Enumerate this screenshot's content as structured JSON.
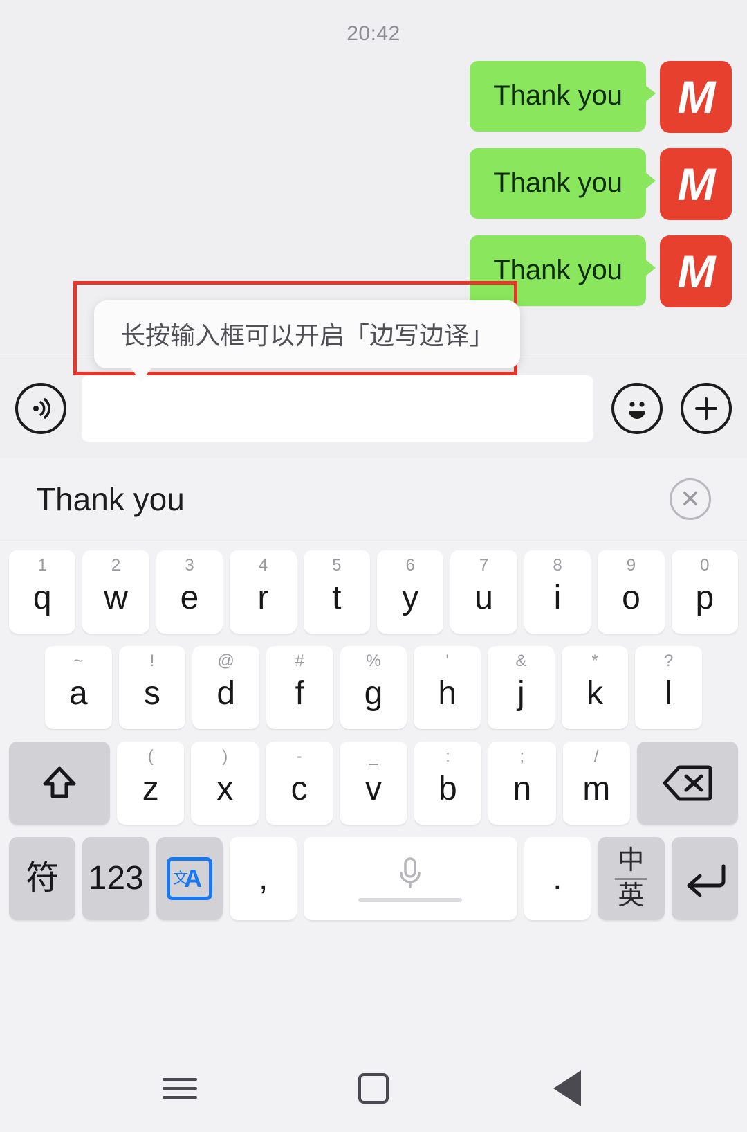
{
  "status": {
    "time": "20:42"
  },
  "chat": {
    "messages": [
      {
        "text": "Thank you",
        "avatar_letter": "M"
      },
      {
        "text": "Thank you",
        "avatar_letter": "M"
      },
      {
        "text": "Thank you",
        "avatar_letter": "M"
      }
    ],
    "bubble_color": "#8ae65c",
    "avatar_color": "#e8402f"
  },
  "tooltip": {
    "text": "长按输入框可以开启「边写边译」",
    "highlight_color": "#e8372a"
  },
  "input_bar": {
    "voice_icon": "voice-wave-icon",
    "field_value": "",
    "field_placeholder": "",
    "emoji_icon": "smiley-face-icon",
    "plus_icon": "plus-icon"
  },
  "keyboard": {
    "candidate": {
      "text": "Thank you",
      "close_icon": "close-circle-icon"
    },
    "row1": [
      {
        "hint": "1",
        "main": "q"
      },
      {
        "hint": "2",
        "main": "w"
      },
      {
        "hint": "3",
        "main": "e"
      },
      {
        "hint": "4",
        "main": "r"
      },
      {
        "hint": "5",
        "main": "t"
      },
      {
        "hint": "6",
        "main": "y"
      },
      {
        "hint": "7",
        "main": "u"
      },
      {
        "hint": "8",
        "main": "i"
      },
      {
        "hint": "9",
        "main": "o"
      },
      {
        "hint": "0",
        "main": "p"
      }
    ],
    "row2": [
      {
        "hint": "~",
        "main": "a"
      },
      {
        "hint": "!",
        "main": "s"
      },
      {
        "hint": "@",
        "main": "d"
      },
      {
        "hint": "#",
        "main": "f"
      },
      {
        "hint": "%",
        "main": "g"
      },
      {
        "hint": "'",
        "main": "h"
      },
      {
        "hint": "&",
        "main": "j"
      },
      {
        "hint": "*",
        "main": "k"
      },
      {
        "hint": "?",
        "main": "l"
      }
    ],
    "row3": [
      {
        "hint": "(",
        "main": "z"
      },
      {
        "hint": ")",
        "main": "x"
      },
      {
        "hint": "-",
        "main": "c"
      },
      {
        "hint": "_",
        "main": "v"
      },
      {
        "hint": ":",
        "main": "b"
      },
      {
        "hint": ";",
        "main": "n"
      },
      {
        "hint": "/",
        "main": "m"
      }
    ],
    "shift_key": {
      "name": "shift-key",
      "icon": "shift-arrow-icon"
    },
    "backspace_key": {
      "name": "backspace-key",
      "icon": "backspace-delete-icon"
    },
    "row4": {
      "symbol_key": "符",
      "numeric_key": "123",
      "translate_key_icon": "translate-icon",
      "translate_key_label": "A",
      "comma_key": ",",
      "space_key_icon": "microphone-icon",
      "period_key": ".",
      "lang_toggle_top": "中",
      "lang_toggle_bottom": "英",
      "enter_key_icon": "enter-return-icon"
    }
  },
  "navbar": {
    "menu_icon": "menu-hamburger-icon",
    "home_icon": "home-square-icon",
    "back_icon": "back-triangle-icon"
  }
}
